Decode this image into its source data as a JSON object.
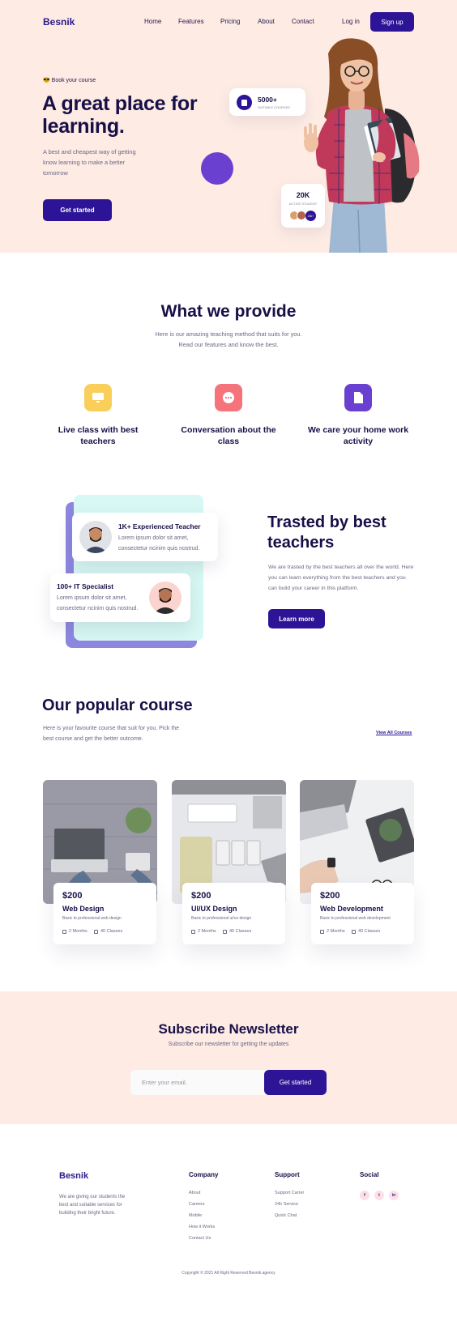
{
  "nav": {
    "logo": "Besnik",
    "items": [
      "Home",
      "Features",
      "Pricing",
      "About",
      "Contact"
    ],
    "login": "Log in",
    "signup": "Sign up"
  },
  "hero": {
    "tag": "😎 Book your course",
    "title": "A great place for learning.",
    "description": "A best and cheapest way of getting know learning to make a better tomorrow",
    "cta": "Get started",
    "stat1_value": "5000+",
    "stat1_label": "SUITABLE COURSES",
    "stat2_value": "20K",
    "stat2_label": "ACTIVE STUDENT",
    "stat2_badge": "20k+"
  },
  "provide": {
    "title": "What we provide",
    "subtitle": "Here is our amazing teaching method that suits for you. Read our features and know the best.",
    "features": [
      {
        "title": "Live class with best teachers",
        "color": "#f9cf5a"
      },
      {
        "title": "Conversation about the class",
        "color": "#f5737a"
      },
      {
        "title": "We care your home work activity",
        "color": "#6a40d1"
      }
    ]
  },
  "trusted": {
    "card1_title": "1K+ Experienced Teacher",
    "card1_text": "Lorem ipsum dolor sit amet, consectetur ncinim quis nostrud.",
    "card2_title": "100+ IT Specialist",
    "card2_text": "Lorem ipsum dolor sit amet, consectetur ncinim quis nostrud.",
    "title": "Trasted by best teachers",
    "description": "We are trasted by the best teachers all over the world. Here you can learn everything from the best teachers and you can build your career in this platform.",
    "cta": "Learn more"
  },
  "courses": {
    "title": "Our popular course",
    "description": "Here is your favourite course that suit for you. Pick the best course and get the better outcome.",
    "view_all": "View All Courses",
    "items": [
      {
        "price": "$200",
        "name": "Web Design",
        "sub": "Basic to professional web design",
        "duration": "2 Months",
        "classes": "40 Classes"
      },
      {
        "price": "$200",
        "name": "UI/UX Design",
        "sub": "Basic to professional ui/ux design",
        "duration": "2 Months",
        "classes": "40 Classes"
      },
      {
        "price": "$200",
        "name": "Web Development",
        "sub": "Basic to professional web development",
        "duration": "2 Months",
        "classes": "40 Classes"
      }
    ]
  },
  "newsletter": {
    "title": "Subscribe Newsletter",
    "subtitle": "Subscribe our newsletter for getting the updates",
    "placeholder": "Enter your email.",
    "button": "Get started"
  },
  "footer": {
    "logo": "Besnik",
    "description": "We are giving our students the best and suitable services for building their bright future.",
    "company_title": "Company",
    "company_links": [
      "About",
      "Careers",
      "Mobile",
      "How it Works",
      "Contact Us"
    ],
    "support_title": "Support",
    "support_links": [
      "Support Carrer",
      "24h Service",
      "Quick Chat"
    ],
    "social_title": "Social",
    "social_icons": [
      "f",
      "t",
      "in"
    ],
    "copyright": "Copyright © 2021 All Right Reserved Besnik.agency"
  }
}
